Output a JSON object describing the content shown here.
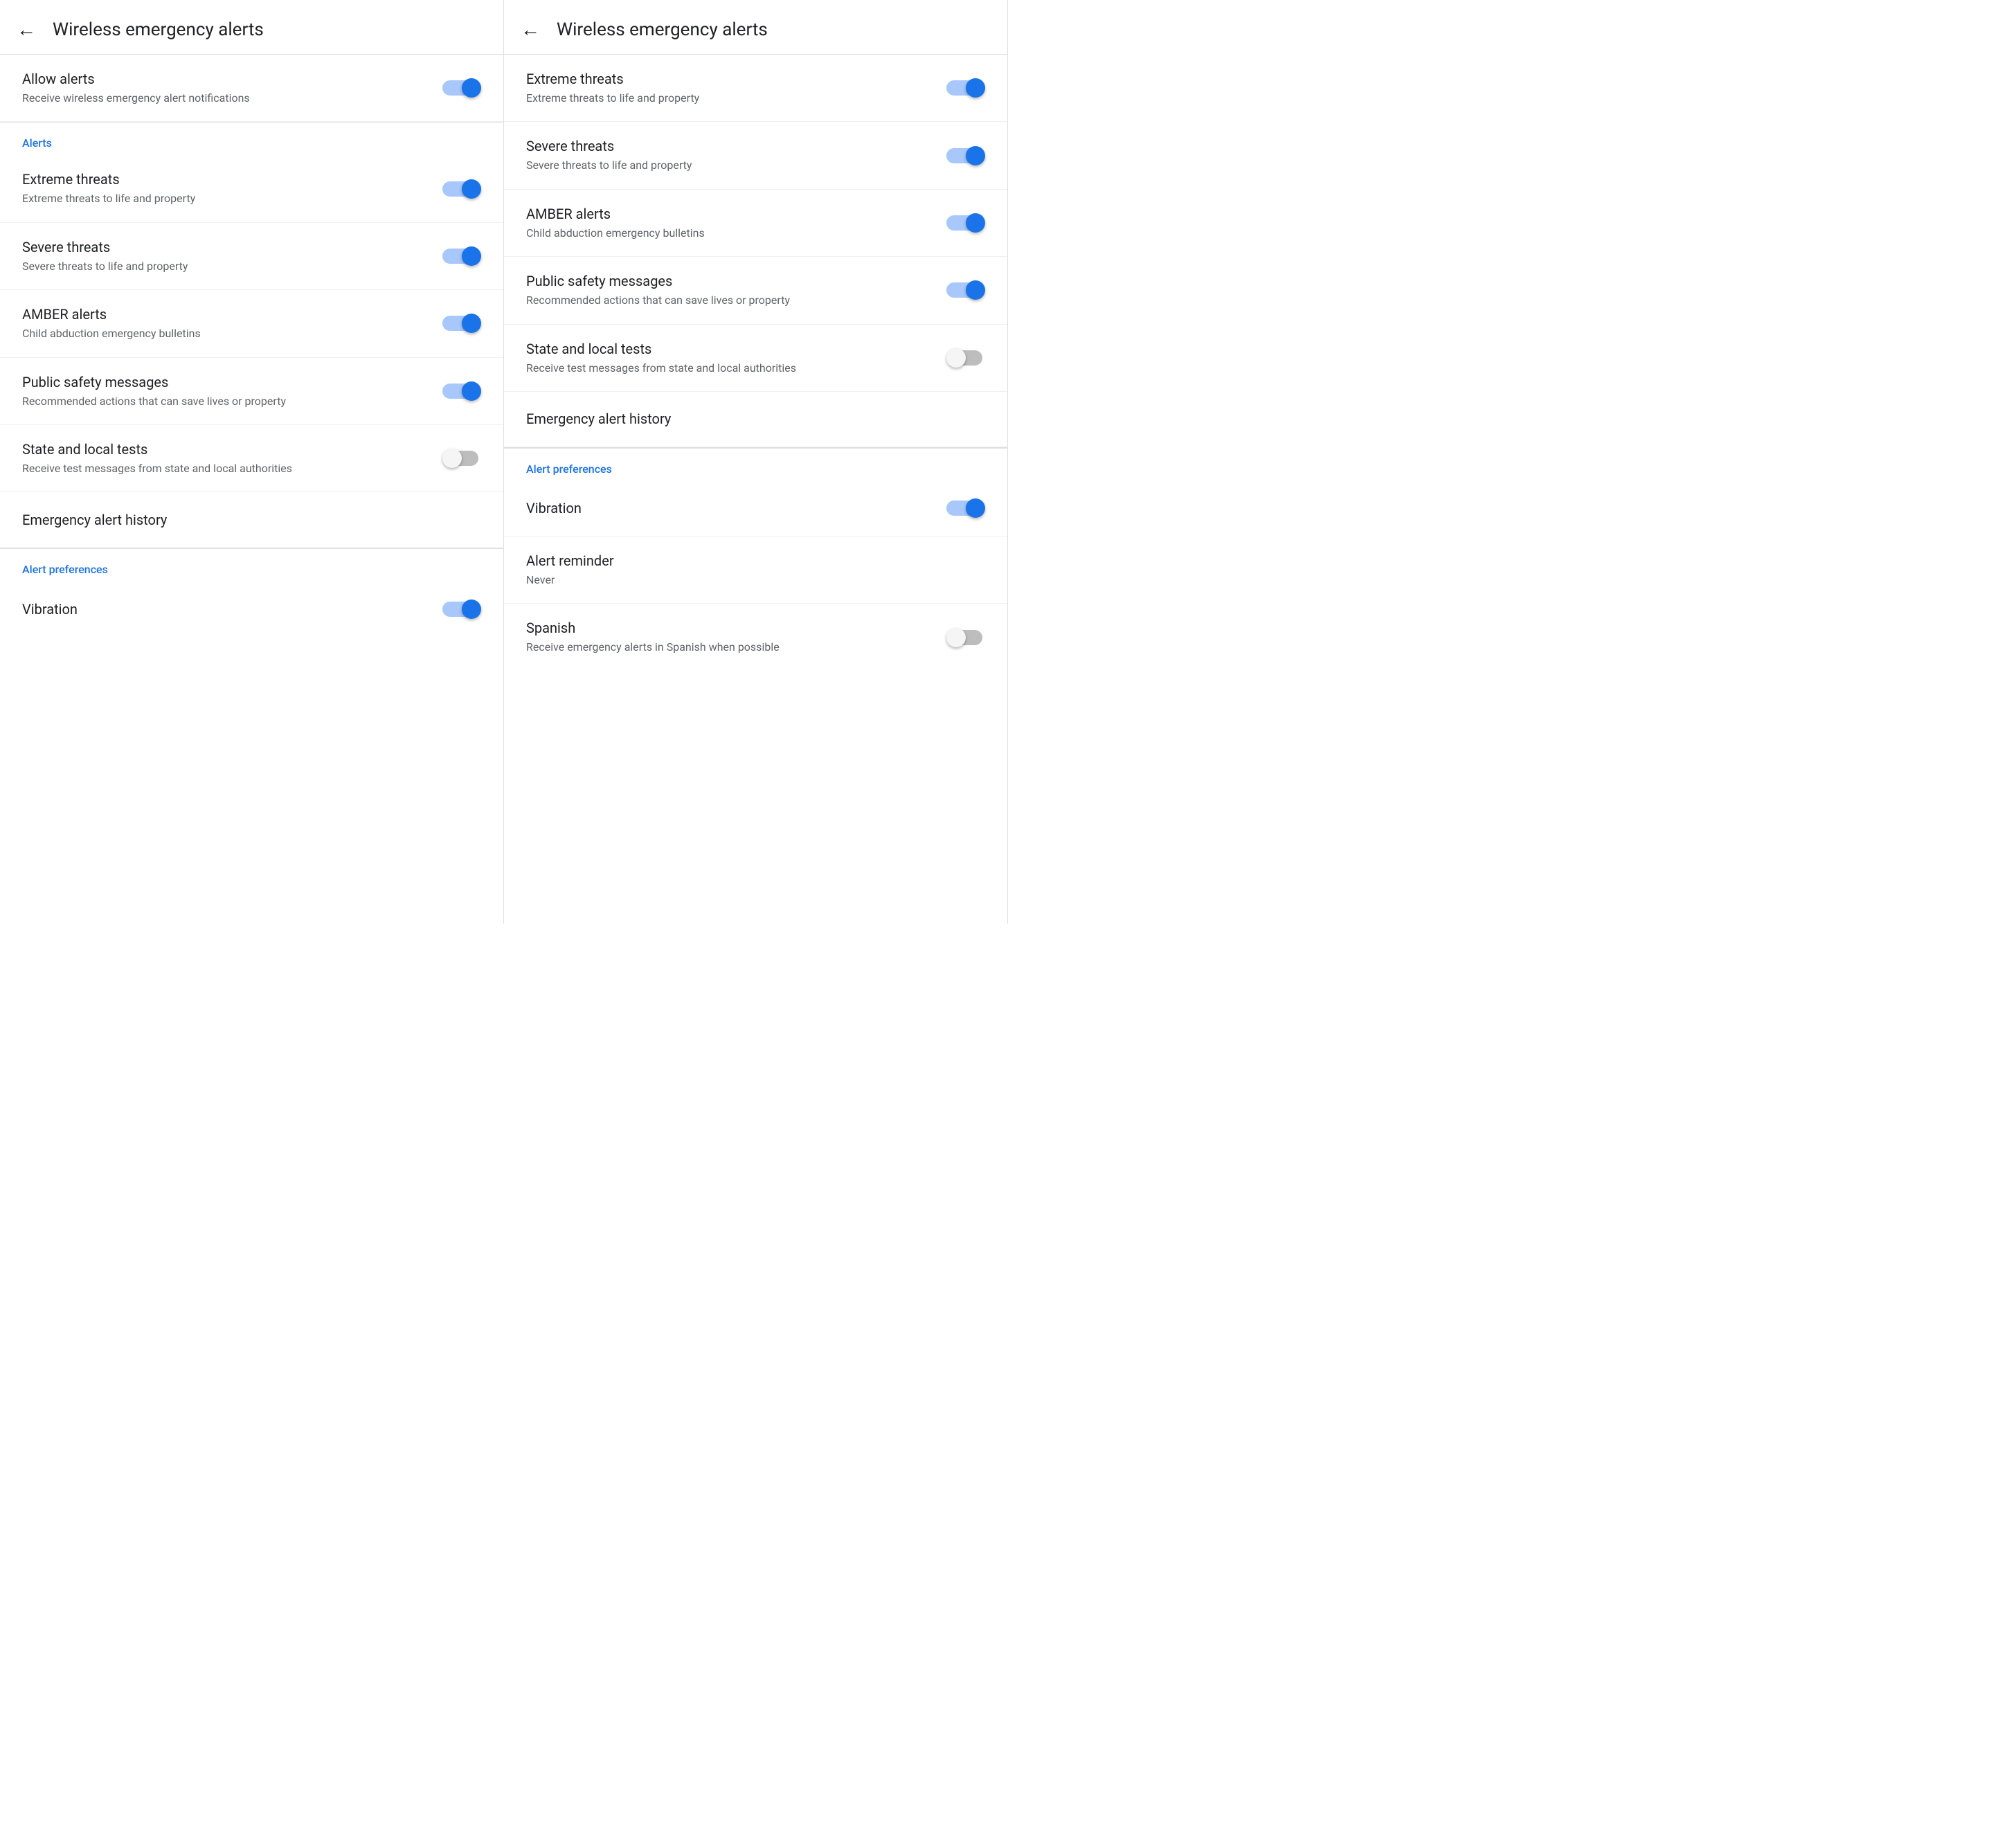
{
  "panel1": {
    "header": {
      "back_label": "←",
      "title": "Wireless emergency alerts"
    },
    "items": [
      {
        "id": "allow-alerts",
        "title": "Allow alerts",
        "subtitle": "Receive wireless emergency alert notifications",
        "has_toggle": true,
        "toggle_on": true
      }
    ],
    "sections": [
      {
        "id": "alerts",
        "label": "Alerts",
        "items": [
          {
            "id": "extreme-threats",
            "title": "Extreme threats",
            "subtitle": "Extreme threats to life and property",
            "has_toggle": true,
            "toggle_on": true
          },
          {
            "id": "severe-threats",
            "title": "Severe threats",
            "subtitle": "Severe threats to life and property",
            "has_toggle": true,
            "toggle_on": true
          },
          {
            "id": "amber-alerts",
            "title": "AMBER alerts",
            "subtitle": "Child abduction emergency bulletins",
            "has_toggle": true,
            "toggle_on": true
          },
          {
            "id": "public-safety",
            "title": "Public safety messages",
            "subtitle": "Recommended actions that can save lives or property",
            "has_toggle": true,
            "toggle_on": true
          },
          {
            "id": "state-local-tests",
            "title": "State and local tests",
            "subtitle": "Receive test messages from state and local authorities",
            "has_toggle": true,
            "toggle_on": false
          },
          {
            "id": "emergency-history",
            "title": "Emergency alert history",
            "subtitle": "",
            "has_toggle": false,
            "toggle_on": false
          }
        ]
      },
      {
        "id": "alert-preferences",
        "label": "Alert preferences",
        "items": [
          {
            "id": "vibration",
            "title": "Vibration",
            "subtitle": "",
            "has_toggle": true,
            "toggle_on": true
          }
        ]
      }
    ]
  },
  "panel2": {
    "header": {
      "back_label": "←",
      "title": "Wireless emergency alerts"
    },
    "sections": [
      {
        "id": "alerts",
        "label": "",
        "items": [
          {
            "id": "extreme-threats",
            "title": "Extreme threats",
            "subtitle": "Extreme threats to life and property",
            "has_toggle": true,
            "toggle_on": true
          },
          {
            "id": "severe-threats",
            "title": "Severe threats",
            "subtitle": "Severe threats to life and property",
            "has_toggle": true,
            "toggle_on": true
          },
          {
            "id": "amber-alerts",
            "title": "AMBER alerts",
            "subtitle": "Child abduction emergency bulletins",
            "has_toggle": true,
            "toggle_on": true
          },
          {
            "id": "public-safety",
            "title": "Public safety messages",
            "subtitle": "Recommended actions that can save lives or property",
            "has_toggle": true,
            "toggle_on": true
          },
          {
            "id": "state-local-tests",
            "title": "State and local tests",
            "subtitle": "Receive test messages from state and local authorities",
            "has_toggle": true,
            "toggle_on": false
          },
          {
            "id": "emergency-history",
            "title": "Emergency alert history",
            "subtitle": "",
            "has_toggle": false,
            "toggle_on": false
          }
        ]
      },
      {
        "id": "alert-preferences",
        "label": "Alert preferences",
        "items": [
          {
            "id": "vibration",
            "title": "Vibration",
            "subtitle": "",
            "has_toggle": true,
            "toggle_on": true
          },
          {
            "id": "alert-reminder",
            "title": "Alert reminder",
            "subtitle": "Never",
            "has_toggle": false,
            "toggle_on": false
          },
          {
            "id": "spanish",
            "title": "Spanish",
            "subtitle": "Receive emergency alerts in Spanish when possible",
            "has_toggle": true,
            "toggle_on": false
          }
        ]
      }
    ]
  }
}
